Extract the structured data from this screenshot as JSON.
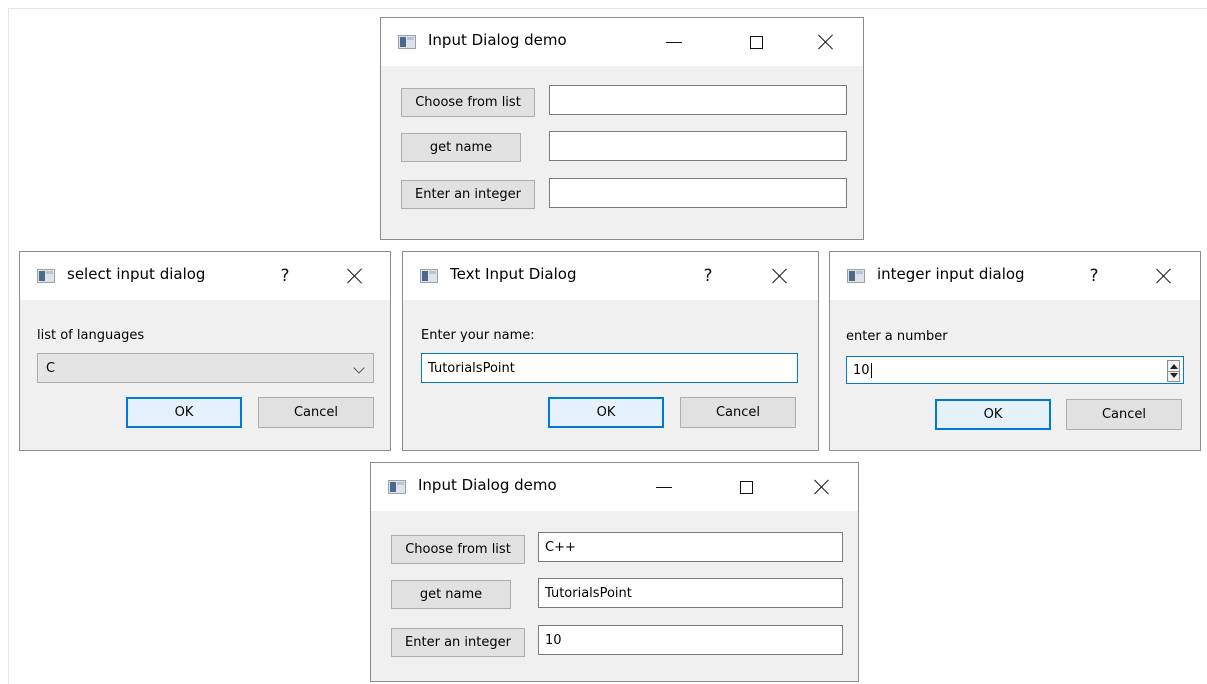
{
  "demo_top": {
    "title": "Input Dialog demo",
    "buttons": {
      "choose": "Choose from list",
      "get_name": "get name",
      "enter_integer": "Enter an integer"
    },
    "fields": {
      "choose": "",
      "name": "",
      "integer": ""
    }
  },
  "select_dialog": {
    "title": "select input dialog",
    "help": "?",
    "label": "list of languages",
    "combo_value": "C",
    "ok": "OK",
    "cancel": "Cancel"
  },
  "text_dialog": {
    "title": "Text Input Dialog",
    "help": "?",
    "label": "Enter your name:",
    "value": "TutorialsPoint",
    "ok": "OK",
    "cancel": "Cancel"
  },
  "integer_dialog": {
    "title": "integer input dialog",
    "help": "?",
    "label": "enter a number",
    "value": "10",
    "ok": "OK",
    "cancel": "Cancel"
  },
  "demo_bottom": {
    "title": "Input Dialog demo",
    "buttons": {
      "choose": "Choose from list",
      "get_name": "get name",
      "enter_integer": "Enter an integer"
    },
    "fields": {
      "choose": "C++",
      "name": "TutorialsPoint",
      "integer": "10"
    }
  },
  "icons": {
    "app": "app-window-icon",
    "minimize": "minimize-icon",
    "maximize": "maximize-icon",
    "close": "close-icon",
    "dropdown": "chevron-down-icon",
    "spin": "spin-arrows-icon"
  }
}
